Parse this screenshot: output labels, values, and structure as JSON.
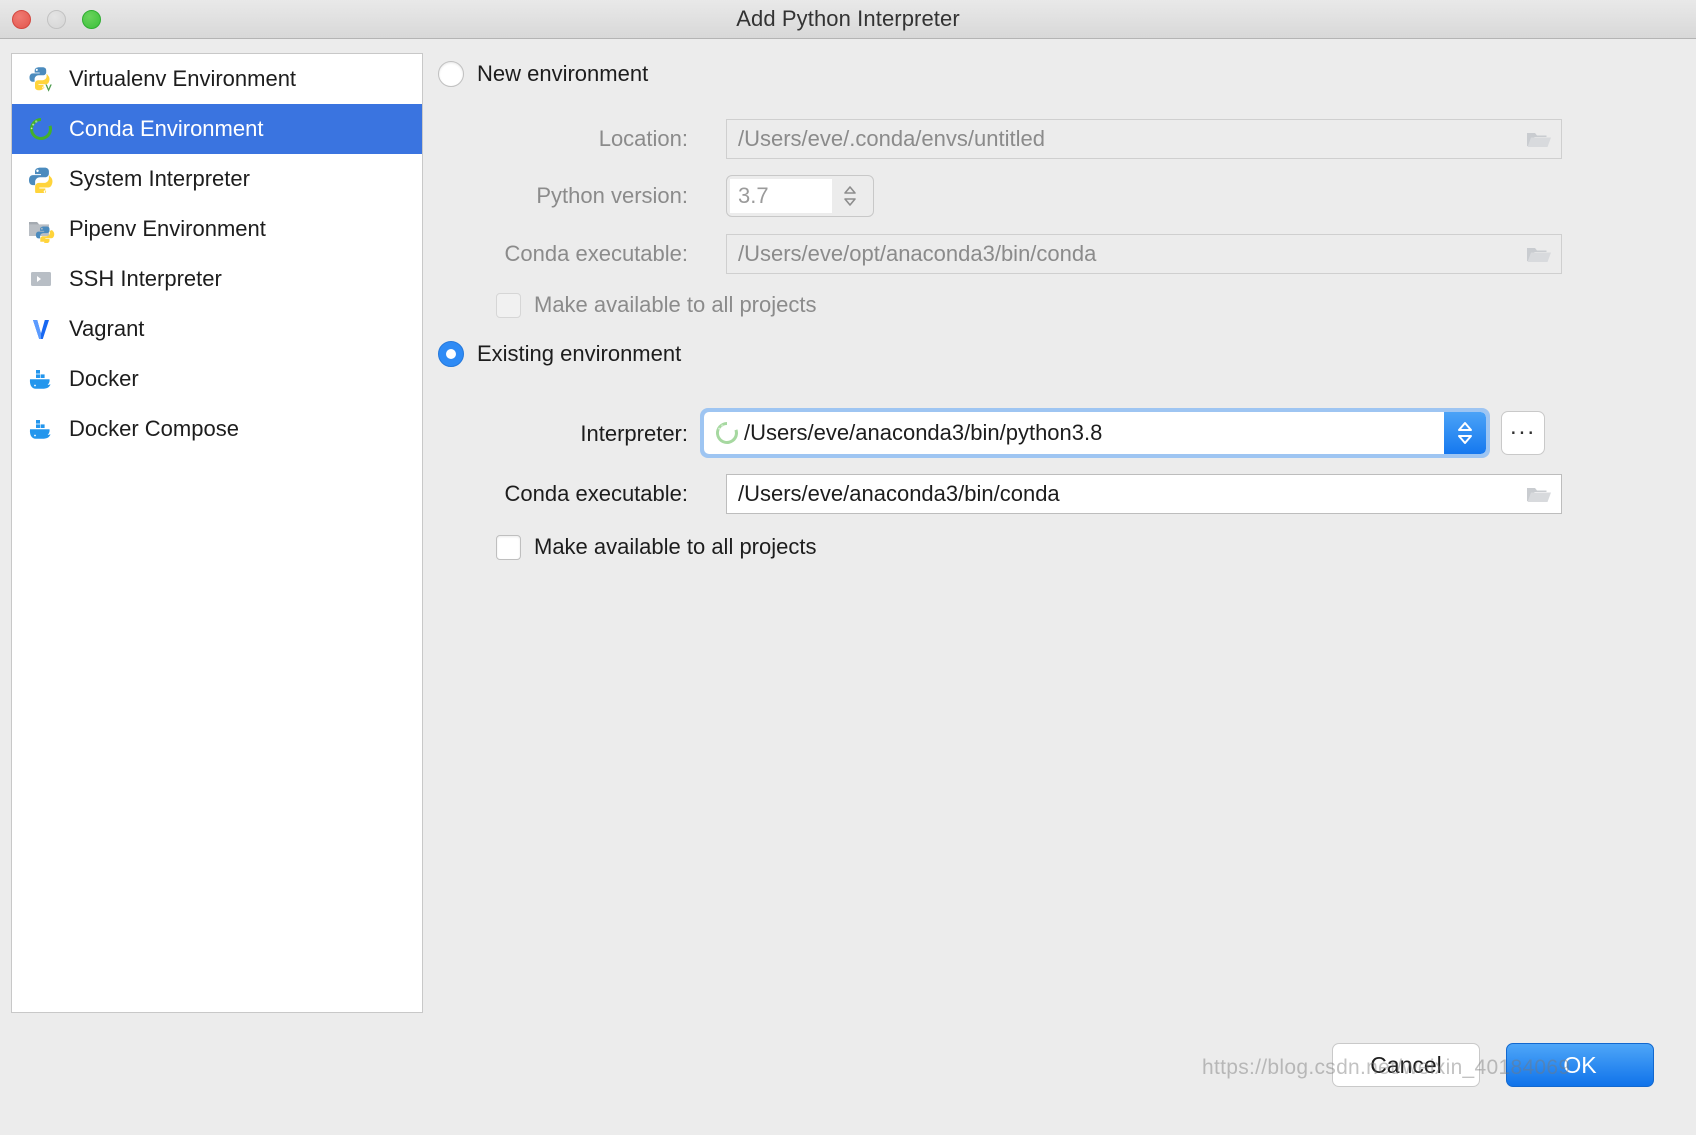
{
  "window": {
    "title": "Add Python Interpreter",
    "controls": {
      "close": "close-button",
      "minimize": "minimize-button",
      "maximize": "maximize-button"
    }
  },
  "sidebar": {
    "items": [
      {
        "label": "Virtualenv Environment",
        "icon": "python-virtualenv-icon",
        "selected": false
      },
      {
        "label": "Conda Environment",
        "icon": "conda-icon",
        "selected": true
      },
      {
        "label": "System Interpreter",
        "icon": "python-icon",
        "selected": false
      },
      {
        "label": "Pipenv Environment",
        "icon": "pipenv-folder-icon",
        "selected": false
      },
      {
        "label": "SSH Interpreter",
        "icon": "ssh-terminal-icon",
        "selected": false
      },
      {
        "label": "Vagrant",
        "icon": "vagrant-icon",
        "selected": false
      },
      {
        "label": "Docker",
        "icon": "docker-icon",
        "selected": false
      },
      {
        "label": "Docker Compose",
        "icon": "docker-compose-icon",
        "selected": false
      }
    ]
  },
  "new_environment": {
    "radio_label": "New environment",
    "selected": false,
    "location": {
      "label": "Location:",
      "value": "/Users/eve/.conda/envs/untitled",
      "enabled": false,
      "browse_icon": "folder-icon"
    },
    "python_version": {
      "label": "Python version:",
      "value": "3.7",
      "enabled": false
    },
    "conda_executable": {
      "label": "Conda executable:",
      "value": "/Users/eve/opt/anaconda3/bin/conda",
      "enabled": false,
      "browse_icon": "folder-icon"
    },
    "make_available": {
      "label": "Make available to all projects",
      "checked": false,
      "enabled": false
    }
  },
  "existing_environment": {
    "radio_label": "Existing environment",
    "selected": true,
    "interpreter": {
      "label": "Interpreter:",
      "value": "/Users/eve/anaconda3/bin/python3.8",
      "icon": "conda-icon",
      "enabled": true,
      "dropdown_icon": "updown-chevron-icon",
      "browse_button_label": "..."
    },
    "conda_executable": {
      "label": "Conda executable:",
      "value": "/Users/eve/anaconda3/bin/conda",
      "enabled": true,
      "browse_icon": "folder-icon"
    },
    "make_available": {
      "label": "Make available to all projects",
      "checked": false,
      "enabled": true
    }
  },
  "footer": {
    "cancel_label": "Cancel",
    "ok_label": "OK"
  },
  "watermark": "https://blog.csdn.net/weixin_40184069",
  "colors": {
    "selection_blue": "#3a74e0",
    "accent_blue": "#2f8bf5",
    "ok_button_blue": "#1073ea",
    "focus_ring_blue": "#9ec5f2",
    "disabled_text": "#8b8b8b",
    "window_background": "#ececec"
  }
}
